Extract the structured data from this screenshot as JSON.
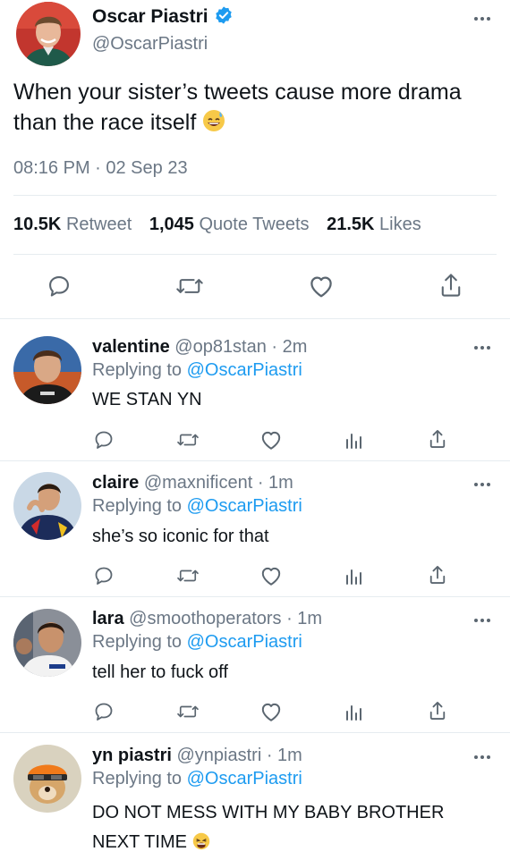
{
  "tweet": {
    "author_name": "Oscar Piastri",
    "author_handle": "@OscarPiastri",
    "text": "When your sister’s tweets cause more drama than the race itself",
    "emoji": "sweat-smile-emoji",
    "timestamp": "08:16 PM · 02 Sep 23",
    "stats": {
      "retweets_count": "10.5K",
      "retweets_label": "Retweet",
      "quotes_count": "1,045",
      "quotes_label": "Quote Tweets",
      "likes_count": "21.5K",
      "likes_label": "Likes"
    },
    "verified_color": "#1d9bf0"
  },
  "replies": [
    {
      "name": "valentine",
      "meta": "@op81stan · 2m",
      "replying_label": "Replying to",
      "replying_to": "@OscarPiastri",
      "text": "WE STAN YN"
    },
    {
      "name": "claire",
      "meta": "@maxnificent · 1m",
      "replying_label": "Replying to",
      "replying_to": "@OscarPiastri",
      "text": "she’s so iconic for that"
    },
    {
      "name": "lara",
      "meta": "@smoothoperators · 1m",
      "replying_label": "Replying to",
      "replying_to": "@OscarPiastri",
      "text": "tell her to fuck off"
    },
    {
      "name": "yn piastri",
      "meta": "@ynpiastri · 1m",
      "replying_label": "Replying to",
      "replying_to": "@OscarPiastri",
      "text_line1": "DO NOT MESS WITH MY BABY BROTHER",
      "text_line2": "NEXT TIME",
      "emoji": "weary-face-emoji"
    }
  ],
  "colors": {
    "link": "#1d9bf0",
    "muted": "#6b7785",
    "divider": "#e6ecf0",
    "icon": "#5b6670"
  }
}
